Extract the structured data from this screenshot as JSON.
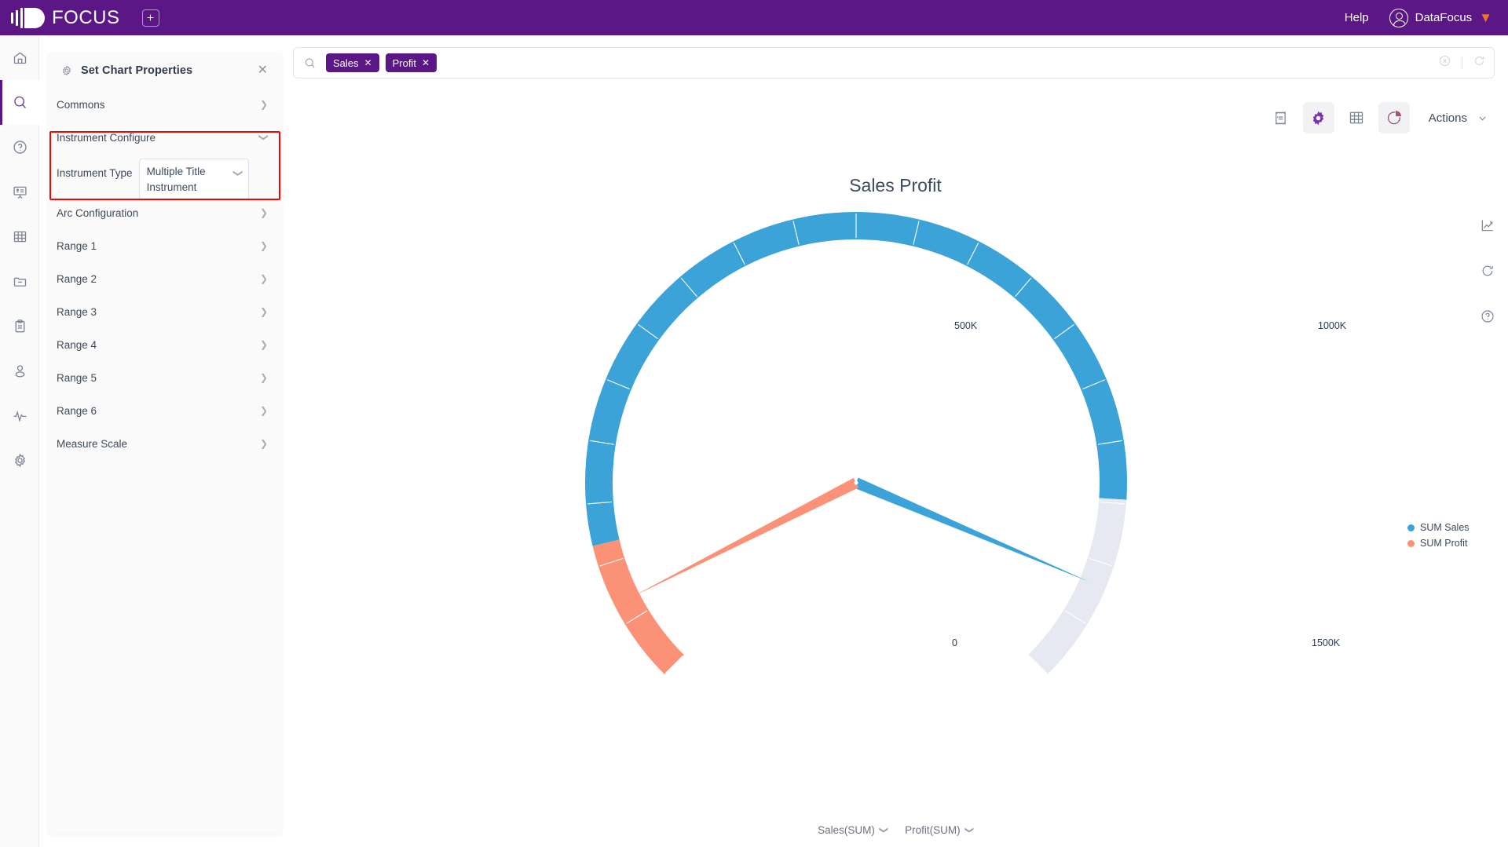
{
  "topbar": {
    "brand": "FOCUS",
    "new_tab_icon": "plus-icon",
    "help": "Help",
    "user": "DataFocus"
  },
  "rail": {
    "items": [
      {
        "name": "home-icon",
        "active": false
      },
      {
        "name": "search-icon",
        "active": true
      },
      {
        "name": "question-icon",
        "active": false
      },
      {
        "name": "presentation-icon",
        "active": false
      },
      {
        "name": "table-icon",
        "active": false
      },
      {
        "name": "folder-icon",
        "active": false
      },
      {
        "name": "clipboard-icon",
        "active": false
      },
      {
        "name": "user-icon",
        "active": false
      },
      {
        "name": "pulse-icon",
        "active": false
      },
      {
        "name": "gear-icon",
        "active": false
      }
    ]
  },
  "panel": {
    "title": "Set Chart Properties",
    "gear_icon": "gear-icon",
    "close_icon": "close-icon",
    "sections": [
      {
        "label": "Commons",
        "expanded": false
      },
      {
        "label": "Instrument Configure",
        "expanded": true
      },
      {
        "label": "Arc Configuration",
        "expanded": false
      },
      {
        "label": "Range 1",
        "expanded": false
      },
      {
        "label": "Range 2",
        "expanded": false
      },
      {
        "label": "Range 3",
        "expanded": false
      },
      {
        "label": "Range 4",
        "expanded": false
      },
      {
        "label": "Range 5",
        "expanded": false
      },
      {
        "label": "Range 6",
        "expanded": false
      },
      {
        "label": "Measure Scale",
        "expanded": false
      }
    ],
    "instrument_type": {
      "label": "Instrument Type",
      "value": "Multiple Title Instrument",
      "chevron_icon": "chevron-down-icon"
    },
    "highlight_color": "#ff0000"
  },
  "search": {
    "icon": "search-icon",
    "chips": [
      {
        "label": "Sales",
        "remove_icon": "close-icon"
      },
      {
        "label": "Profit",
        "remove_icon": "close-icon"
      }
    ],
    "clear_icon": "clear-circle-icon",
    "refresh_icon": "refresh-icon"
  },
  "toolbar": {
    "buttons": [
      {
        "name": "receipt-icon",
        "active": false
      },
      {
        "name": "gear-icon",
        "active": true
      },
      {
        "name": "table-icon",
        "active": false
      },
      {
        "name": "pie-chart-icon",
        "active": true
      }
    ],
    "actions_label": "Actions",
    "actions_chevron": "chevron-down-icon"
  },
  "side_tools": [
    {
      "name": "trend-chart-icon"
    },
    {
      "name": "refresh-icon"
    },
    {
      "name": "help-circle-icon"
    }
  ],
  "footer": {
    "measures": [
      {
        "label": "Sales(SUM)",
        "chevron": "chevron-down-icon"
      },
      {
        "label": "Profit(SUM)",
        "chevron": "chevron-down-icon"
      }
    ]
  },
  "chart_data": {
    "type": "gauge",
    "title": "Sales Profit",
    "min": 0,
    "max": 1500000,
    "tick_labels": [
      "0",
      "500K",
      "1000K",
      "1500K"
    ],
    "tick_values": [
      0,
      500000,
      1000000,
      1500000
    ],
    "start_angle_deg": 225,
    "end_angle_deg": -45,
    "track_color": "#e6e9f2",
    "series": [
      {
        "name": "SUM Sales",
        "value": 1270000,
        "color": "#3ba3d8",
        "needle_angle_deg": -23
      },
      {
        "name": "SUM Profit",
        "value": 175000,
        "color": "#fb9277",
        "needle_angle_deg": 207
      }
    ],
    "legend": {
      "position": "right",
      "entries": [
        {
          "label": "SUM Sales",
          "color": "#3ba3d8"
        },
        {
          "label": "SUM Profit",
          "color": "#fb9277"
        }
      ]
    },
    "arcs": [
      {
        "name": "profit-arc",
        "from": 0,
        "to": 175000,
        "color": "#fb9277"
      },
      {
        "name": "sales-arc",
        "from": 175000,
        "to": 1270000,
        "color": "#3ba3d8"
      },
      {
        "name": "remainder-arc",
        "from": 1270000,
        "to": 1500000,
        "color": "#e6e9f2"
      }
    ]
  }
}
